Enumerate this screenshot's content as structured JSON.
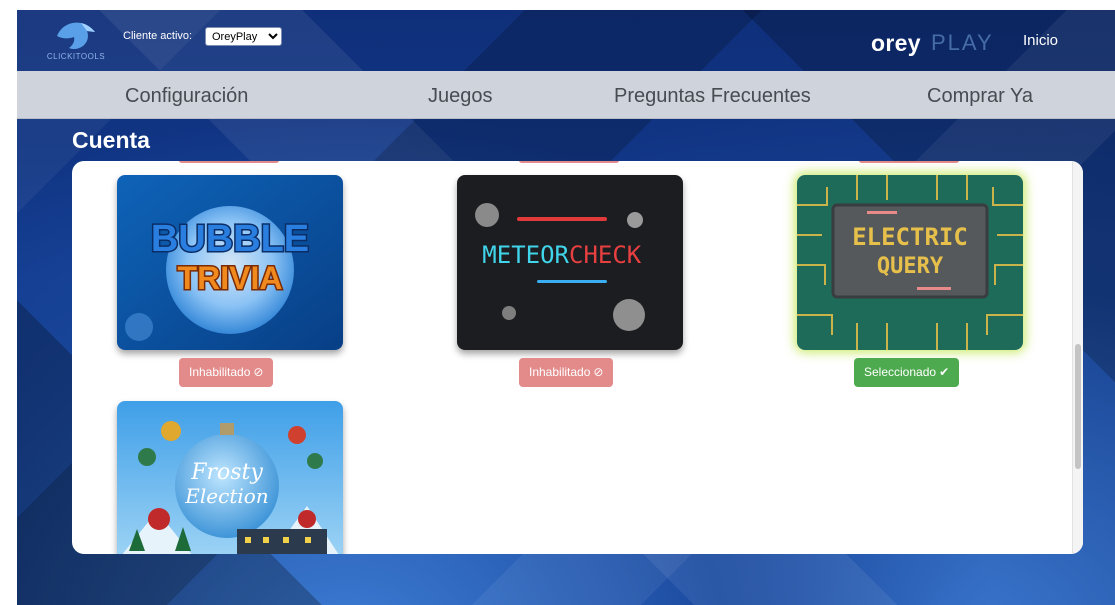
{
  "header": {
    "logo_text": "CLICKITOOLS",
    "client_label": "Cliente activo:",
    "client_selected": "OreyPlay",
    "brand_main": "orey",
    "brand_accent": "PLAY",
    "home_link": "Inicio"
  },
  "nav": {
    "items": [
      "Configuración",
      "Juegos",
      "Preguntas Frecuentes",
      "Comprar Ya"
    ]
  },
  "section_title": "Cuenta",
  "games": [
    {
      "title_line1": "BUBBLE",
      "title_line2": "TRIVIA",
      "status": "Inhabilitado",
      "status_icon": "ban-icon",
      "state": "disabled"
    },
    {
      "title_line1": "METEOR",
      "title_line2": "CHECK",
      "status": "Inhabilitado",
      "status_icon": "ban-icon",
      "state": "disabled"
    },
    {
      "title_line1": "ELECTRIC",
      "title_line2": "QUERY",
      "status": "Seleccionado",
      "status_icon": "check-icon",
      "state": "selected"
    },
    {
      "title_line1": "Frosty",
      "title_line2": "Election"
    }
  ],
  "glyphs": {
    "ban": "⊘",
    "check": "✔"
  },
  "colors": {
    "disabled_badge": "#e38a8a",
    "selected_badge": "#4eaa4f",
    "nav_bg": "#cfd3db",
    "panel_bg": "#ffffff"
  }
}
